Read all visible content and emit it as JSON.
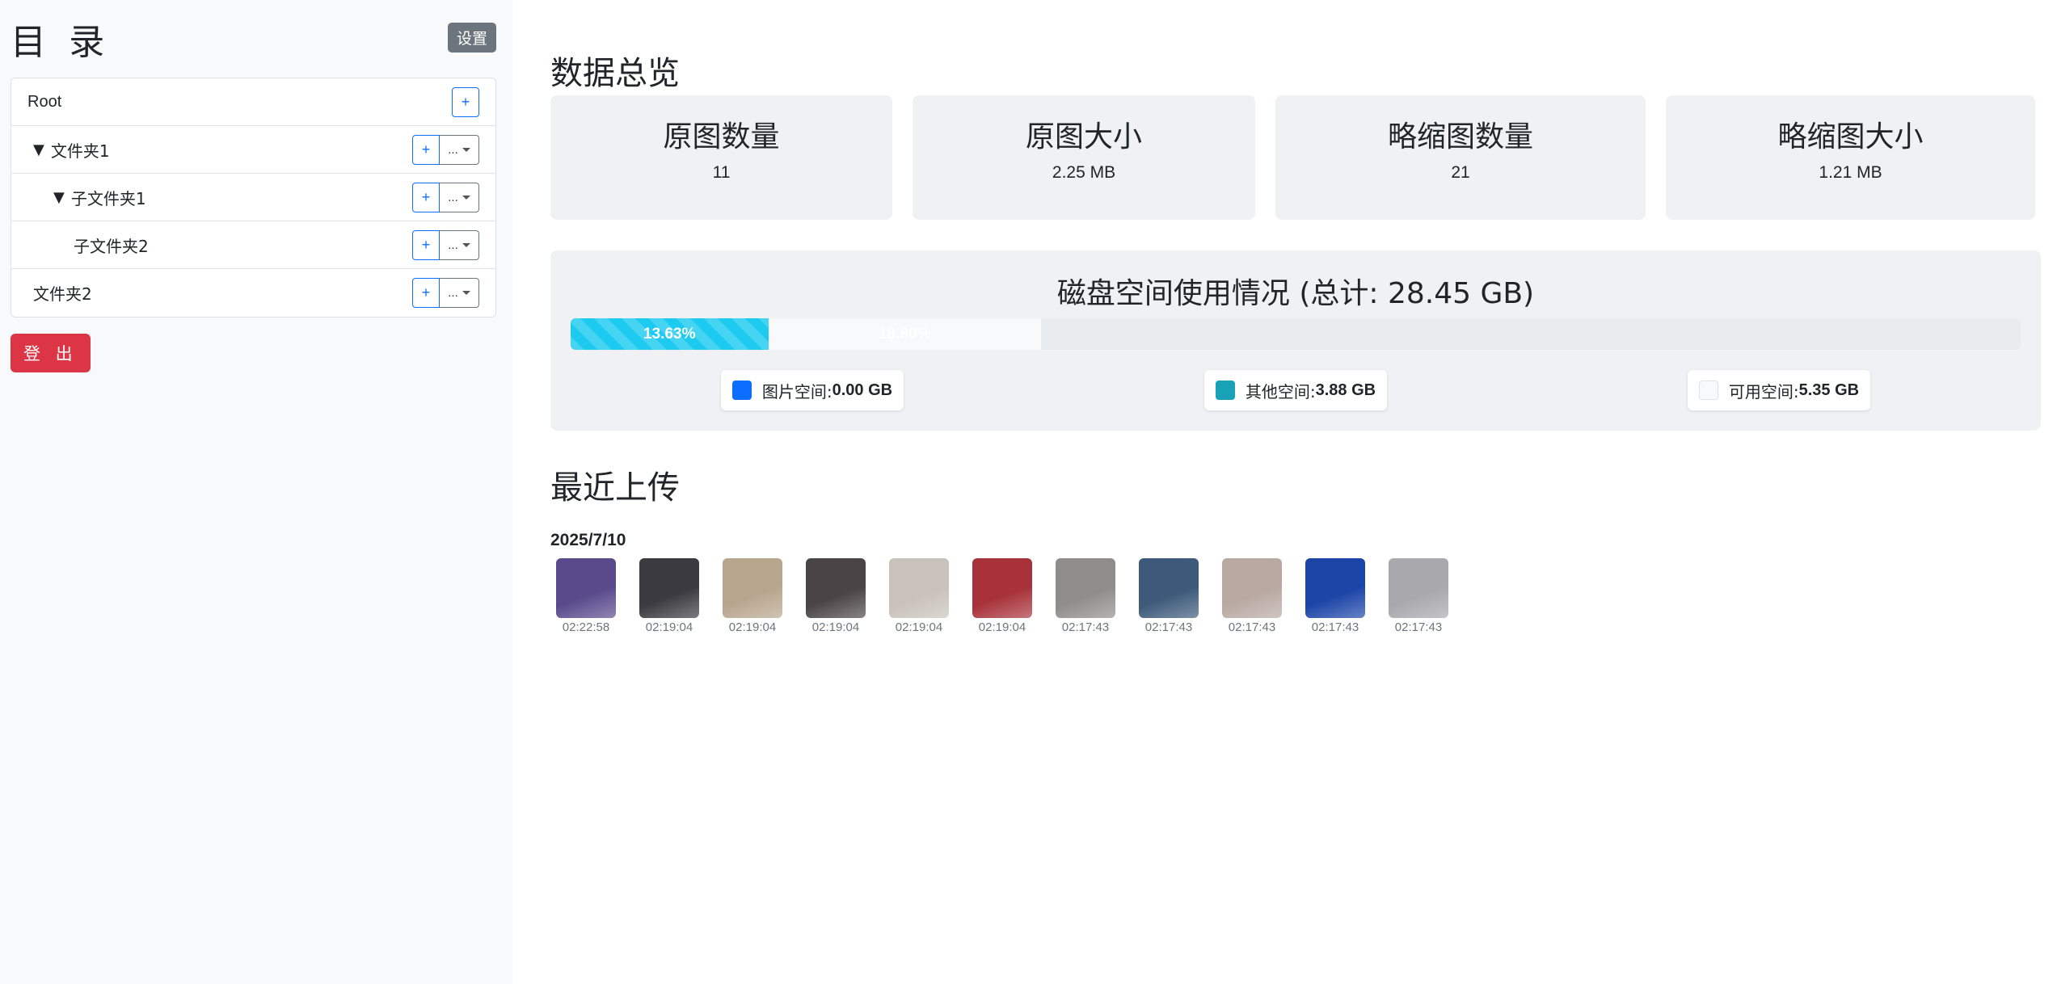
{
  "sidebar": {
    "title": "目 录",
    "settings_label": "设置",
    "logout_label": "登 出",
    "tree": [
      {
        "label": "Root",
        "caret": "",
        "indent": 0,
        "add": "+",
        "more": ""
      },
      {
        "label": "文件夹1",
        "caret": "▼",
        "indent": 1,
        "add": "+",
        "more": "..."
      },
      {
        "label": "子文件夹1",
        "caret": "▼",
        "indent": 2,
        "add": "+",
        "more": "..."
      },
      {
        "label": "子文件夹2",
        "caret": "",
        "indent": 3,
        "add": "+",
        "more": "..."
      },
      {
        "label": "文件夹2",
        "caret": "",
        "indent": 1,
        "add": "+",
        "more": "..."
      }
    ]
  },
  "overview": {
    "title": "数据总览",
    "stats": [
      {
        "label": "原图数量",
        "value": "11"
      },
      {
        "label": "原图大小",
        "value": "2.25 MB"
      },
      {
        "label": "略缩图数量",
        "value": "21"
      },
      {
        "label": "略缩图大小",
        "value": "1.21 MB"
      }
    ]
  },
  "disk": {
    "title": "磁盘空间使用情况 (总计: 28.45 GB)",
    "segments": [
      {
        "label": "13.63%",
        "percent": 13.63,
        "color": "#1dcaf0"
      },
      {
        "label": "18.80%",
        "percent": 18.8,
        "color": "#f8f9fa"
      }
    ],
    "legend": [
      {
        "label": "图片空间:",
        "value": "0.00 GB",
        "color": "#0d6efd"
      },
      {
        "label": "其他空间:",
        "value": "3.88 GB",
        "color": "#17a2b8"
      },
      {
        "label": "可用空间:",
        "value": "5.35 GB",
        "color": "#f8f9fa"
      }
    ]
  },
  "recent": {
    "title": "最近上传",
    "date": "2025/7/10",
    "items": [
      {
        "time": "02:22:58",
        "color": "#5a4a8c"
      },
      {
        "time": "02:19:04",
        "color": "#3a3a40"
      },
      {
        "time": "02:19:04",
        "color": "#b8a58e"
      },
      {
        "time": "02:19:04",
        "color": "#4b4447"
      },
      {
        "time": "02:19:04",
        "color": "#c8c2ba"
      },
      {
        "time": "02:19:04",
        "color": "#a8323a"
      },
      {
        "time": "02:17:43",
        "color": "#8f8d8a"
      },
      {
        "time": "02:17:43",
        "color": "#3d5a7a"
      },
      {
        "time": "02:17:43",
        "color": "#b9a9a2"
      },
      {
        "time": "02:17:43",
        "color": "#1c45a8"
      },
      {
        "time": "02:17:43",
        "color": "#a8a8ad"
      }
    ]
  }
}
